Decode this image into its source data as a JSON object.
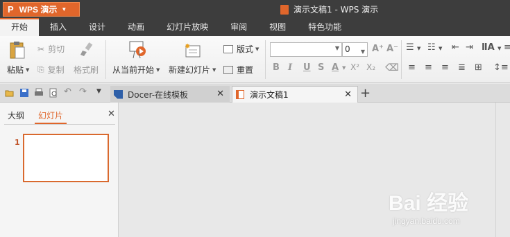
{
  "app": {
    "logo": "P",
    "name": "WPS 演示"
  },
  "window_title": "演示文稿1 - WPS 演示",
  "menu": [
    "开始",
    "插入",
    "设计",
    "动画",
    "幻灯片放映",
    "审阅",
    "视图",
    "特色功能"
  ],
  "ribbon": {
    "paste": "粘贴",
    "cut": "剪切",
    "copy": "复制",
    "format_painter": "格式刷",
    "start_from_current": "从当前开始",
    "new_slide": "新建幻灯片",
    "layout": "版式",
    "reset": "重置",
    "font_size": "0",
    "bold": "B",
    "italic": "I",
    "underline": "U",
    "strike": "S",
    "font_color": "A",
    "superscript": "X²",
    "subscript": "X₂",
    "grow_font": "A⁺",
    "shrink_font": "A⁻"
  },
  "tabs": [
    {
      "label": "Docer-在线模板"
    },
    {
      "label": "演示文稿1"
    }
  ],
  "panel": {
    "outline_tab": "大纲",
    "slides_tab": "幻灯片",
    "slide_number": "1"
  },
  "watermark": {
    "brand": "Bai 经验",
    "url": "jingyan.baidu.com"
  },
  "colors": {
    "accent": "#e0662b",
    "titlebar": "#3d3d3d"
  }
}
